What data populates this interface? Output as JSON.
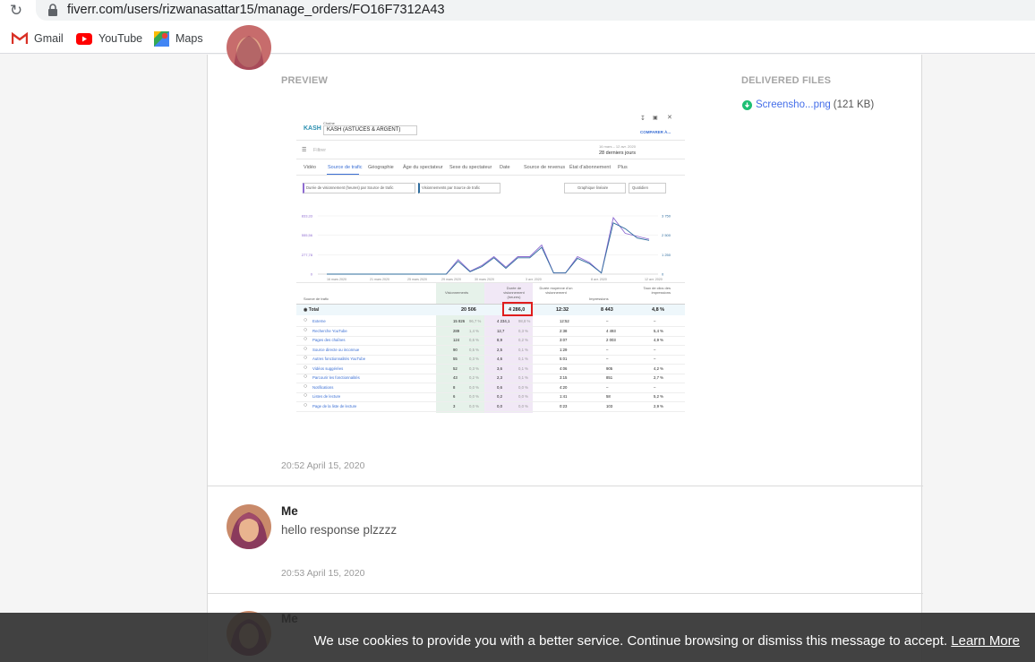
{
  "browser": {
    "url": "fiverr.com/users/rizwanasattar15/manage_orders/FO16F7312A43",
    "bookmarks": [
      {
        "label": "Gmail"
      },
      {
        "label": "YouTube"
      },
      {
        "label": "Maps"
      }
    ]
  },
  "delivery": {
    "preview_label": "PREVIEW",
    "delivered_label": "DELIVERED FILES",
    "file_name": "Screensho...png",
    "file_size": "(121 KB)",
    "timestamp": "20:52  April 15, 2020"
  },
  "preview_image": {
    "channel_label": "Chaîne",
    "channel_name": "KASH (ASTUCES & ARGENT)",
    "logo": "KASH",
    "compare": "COMPARER À...",
    "filter": "Filtrer",
    "date_range_small": "16 mars – 12 avr. 2020",
    "date_range": "28 derniers jours",
    "tabs": [
      "Vidéo",
      "Source de trafic",
      "Géographie",
      "Âge du spectateur",
      "Sexe du spectateur",
      "Date",
      "Source de revenus",
      "État d'abonnement",
      "Plus"
    ],
    "dropdown1": "Durée de visionnement (heures) par Source de trafic",
    "dropdown2": "Visionnements par Source de trafic",
    "dropdown3": "Graphique linéaire",
    "dropdown4": "Quotidien",
    "y_left": [
      "833,33",
      "555,56",
      "277,78",
      "0"
    ],
    "y_right": [
      "3 750",
      "2 500",
      "1 250",
      "0"
    ],
    "x_ticks": [
      "16 mars 2020",
      "21 mars 2020",
      "25 mars 2020",
      "29 mars 2020",
      "30 mars 2020",
      "3 avr. 2020",
      "8 avr. 2020",
      "12 avr. 2020"
    ],
    "headers": [
      "Source de trafic",
      "Visionnements",
      "Durée de visionnement (heures)",
      "Durée moyenne d'un visionnement",
      "Impressions",
      "Taux de clics des impressions"
    ],
    "total": {
      "label": "Total",
      "views": "20 506",
      "watch": "4 286,0",
      "avg": "12:32",
      "impr": "8 443",
      "ctr": "4,8 %"
    },
    "rows": [
      {
        "name": "Externe",
        "views": "15 826",
        "vp": "96,7 %",
        "watch": "4 234,1",
        "wp": "98,8 %",
        "avg": "12:52",
        "impr": "–",
        "ctr": "–"
      },
      {
        "name": "Recherche YouTube",
        "views": "289",
        "vp": "1,4 %",
        "watch": "12,7",
        "wp": "0,3 %",
        "avg": "2:38",
        "impr": "4 493",
        "ctr": "5,4 %"
      },
      {
        "name": "Pages des chaînes",
        "views": "124",
        "vp": "0,6 %",
        "watch": "8,9",
        "wp": "0,2 %",
        "avg": "3:07",
        "impr": "2 003",
        "ctr": "4,9 %"
      },
      {
        "name": "Source directe ou inconnue",
        "views": "90",
        "vp": "0,5 %",
        "watch": "2,5",
        "wp": "0,1 %",
        "avg": "1:29",
        "impr": "–",
        "ctr": "–"
      },
      {
        "name": "Autres fonctionnalités YouTube",
        "views": "55",
        "vp": "0,3 %",
        "watch": "4,6",
        "wp": "0,1 %",
        "avg": "5:01",
        "impr": "–",
        "ctr": "–"
      },
      {
        "name": "Vidéos suggérées",
        "views": "52",
        "vp": "0,3 %",
        "watch": "3,6",
        "wp": "0,1 %",
        "avg": "4:06",
        "impr": "905",
        "ctr": "4,2 %"
      },
      {
        "name": "Parcourir les fonctionnalités",
        "views": "43",
        "vp": "0,2 %",
        "watch": "2,3",
        "wp": "0,1 %",
        "avg": "3:15",
        "impr": "851",
        "ctr": "2,7 %"
      },
      {
        "name": "Notifications",
        "views": "8",
        "vp": "0,0 %",
        "watch": "0,6",
        "wp": "0,0 %",
        "avg": "4:20",
        "impr": "–",
        "ctr": "–"
      },
      {
        "name": "Listes de lecture",
        "views": "6",
        "vp": "0,0 %",
        "watch": "0,2",
        "wp": "0,0 %",
        "avg": "1:41",
        "impr": "58",
        "ctr": "5,2 %"
      },
      {
        "name": "Page de la liste de lecture",
        "views": "3",
        "vp": "0,0 %",
        "watch": "0,0",
        "wp": "0,0 %",
        "avg": "0:23",
        "impr": "103",
        "ctr": "2,9 %"
      }
    ]
  },
  "messages": [
    {
      "sender": "Me",
      "text": "hello response plzzzz",
      "timestamp": "20:53  April 15, 2020"
    },
    {
      "sender": "Me"
    }
  ],
  "cookie": {
    "text": "We use cookies to provide you with a better service. Continue browsing or dismiss this message to accept.",
    "link": "Learn More"
  }
}
